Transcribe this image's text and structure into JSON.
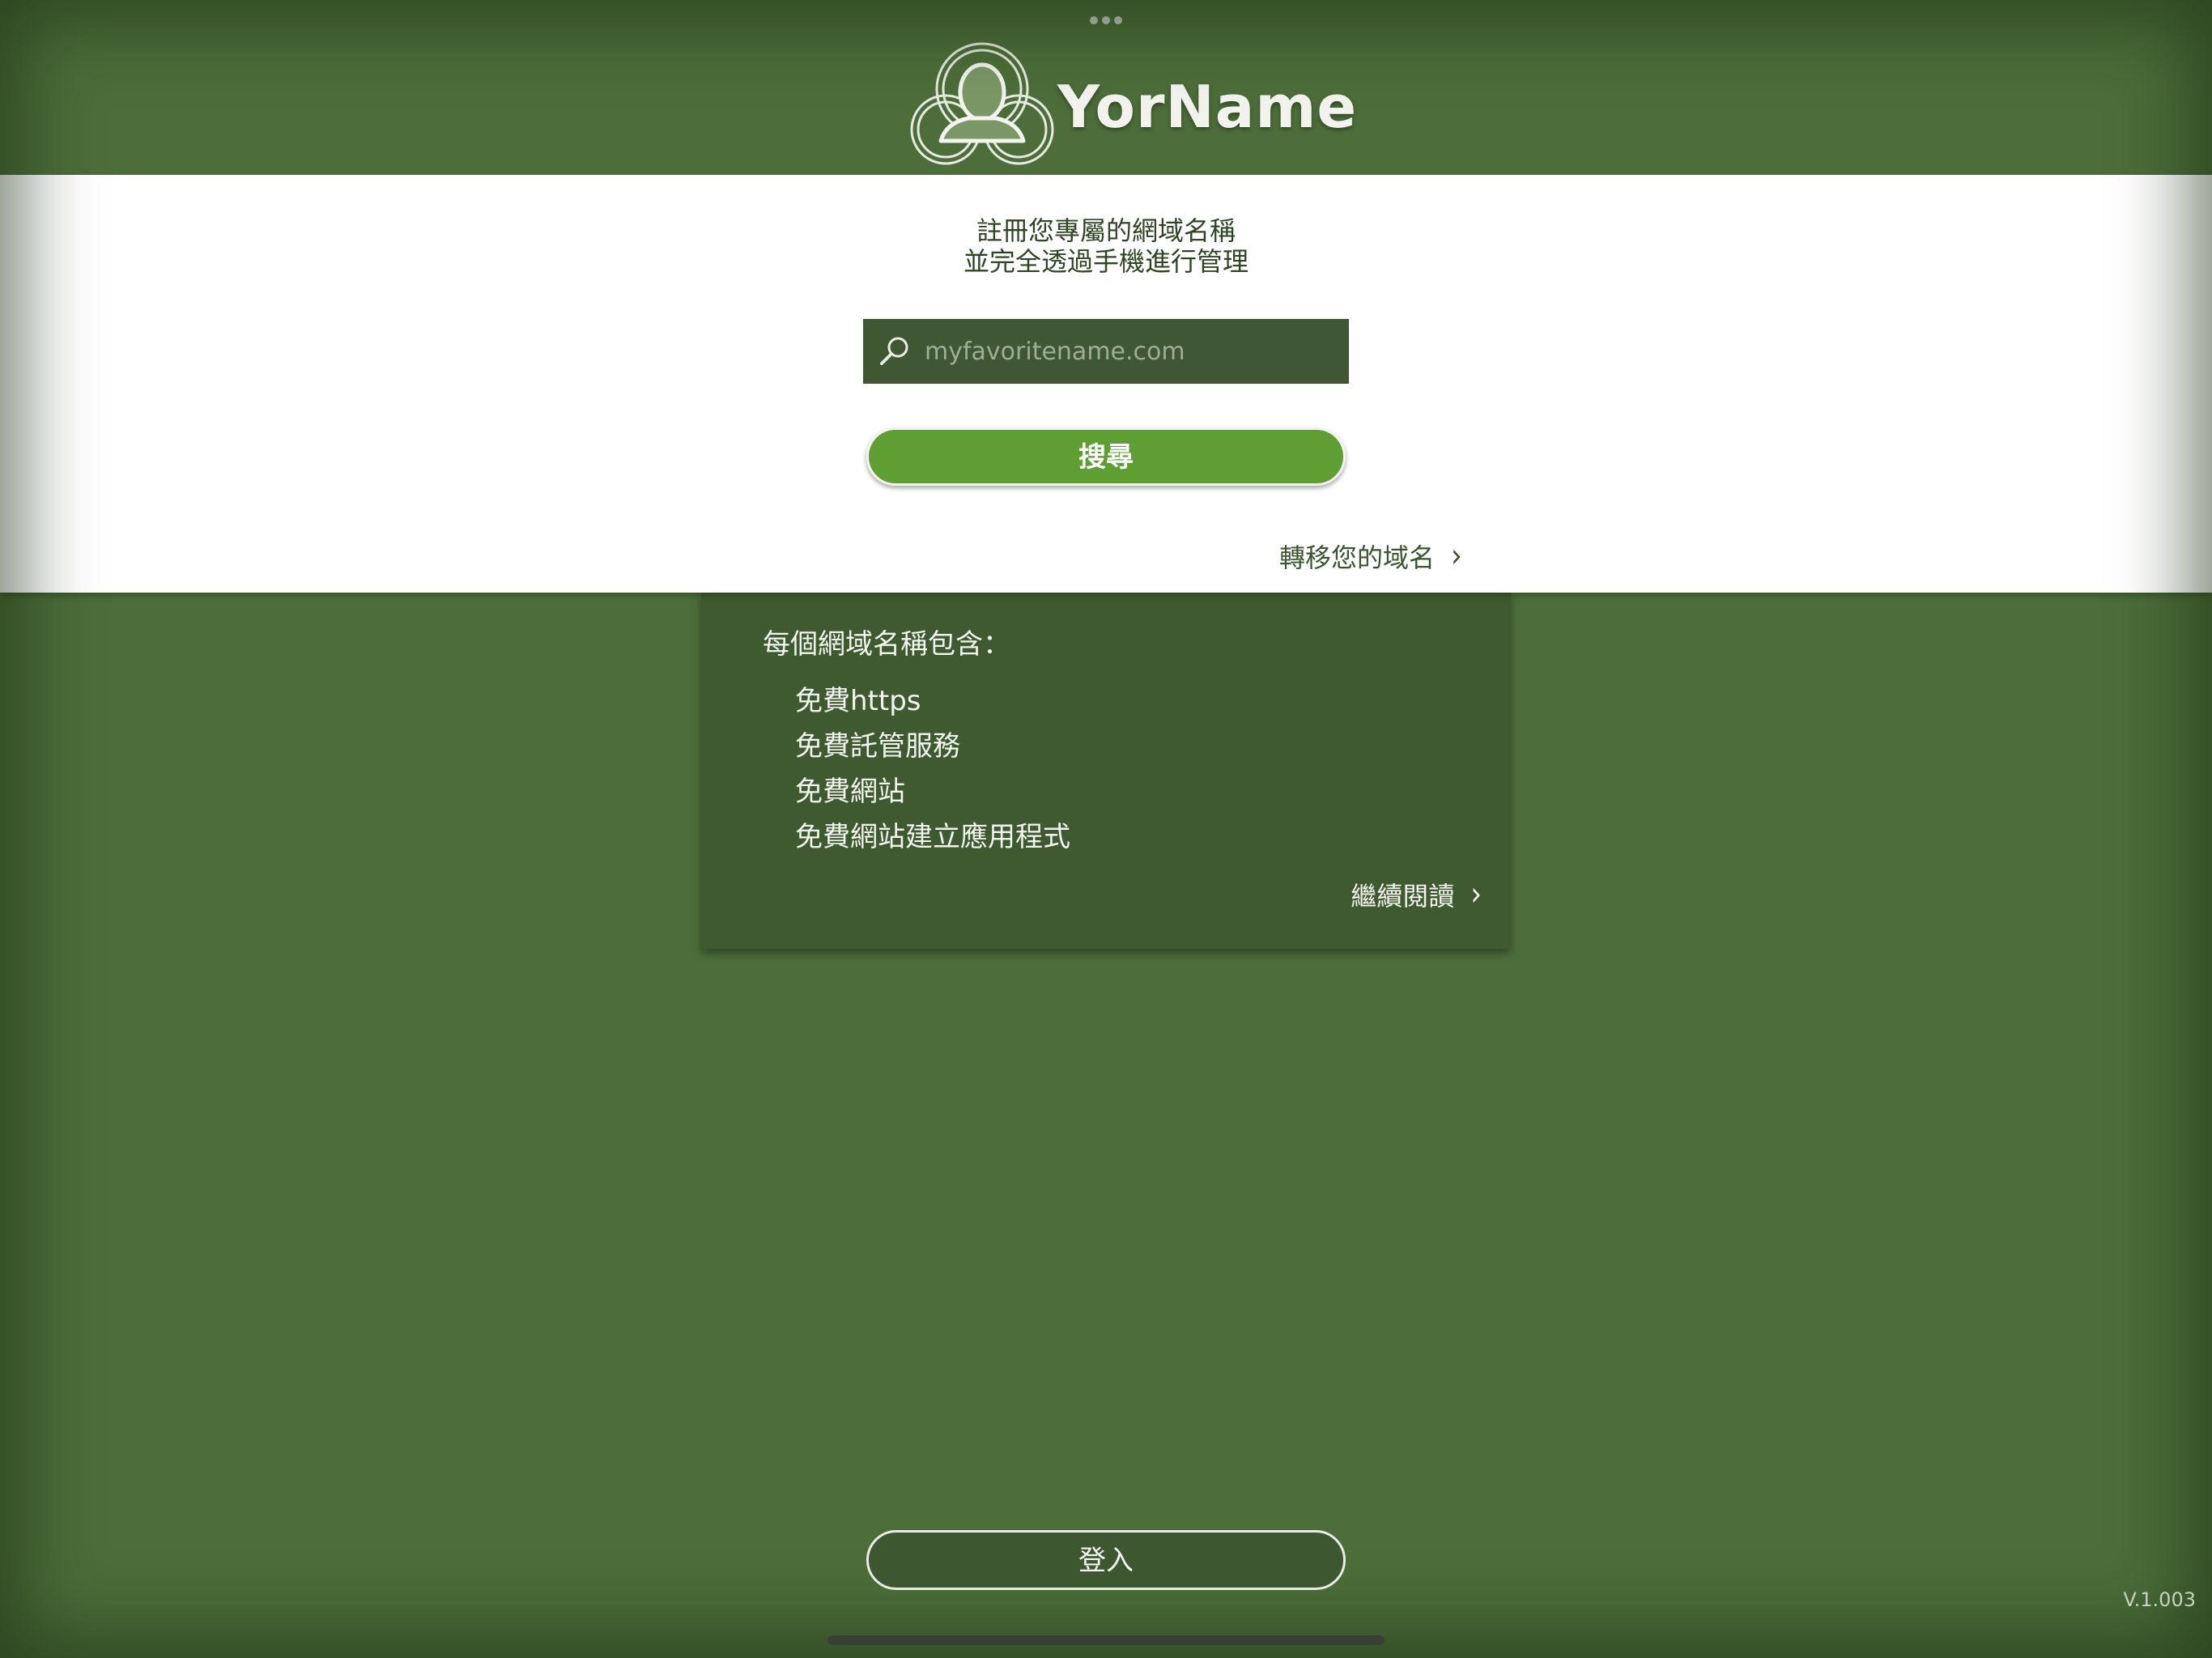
{
  "app": {
    "brand_name": "YorName",
    "version": "V.1.003"
  },
  "hero": {
    "tagline_line1": "註冊您專屬的網域名稱",
    "tagline_line2": "並完全透過手機進行管理"
  },
  "search": {
    "placeholder": "myfavoritename.com",
    "value": "",
    "button_label": "搜尋"
  },
  "transfer": {
    "label": "轉移您的域名",
    "chevron": "›"
  },
  "info": {
    "title": "每個網域名稱包含：",
    "features": [
      "免費https",
      "免費託管服務",
      "免費網站",
      "免費網站建立應用程式"
    ],
    "read_more": "繼續閱讀",
    "chevron": "›"
  },
  "login": {
    "label": "登入"
  },
  "icons": {
    "logo": "person-avatar-logo-icon",
    "search": "magnifier-icon",
    "chevron": "chevron-right-icon"
  },
  "colors": {
    "background": "#4d6e3a",
    "panel": "#ffffff",
    "card": "#3f5a31",
    "search_box": "#3f5833",
    "search_button": "#5e9e33",
    "login_button": "#3d5731"
  }
}
